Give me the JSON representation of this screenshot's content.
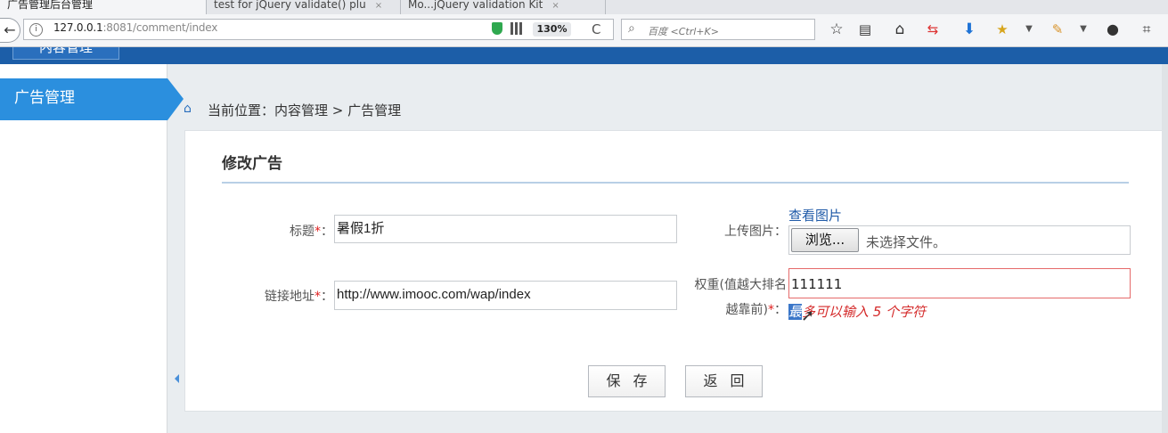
{
  "browser": {
    "tabs": [
      {
        "label": "广告管理后台管理",
        "active": true
      },
      {
        "label": "test for jQuery validate() plu"
      },
      {
        "label": "Mo...jQuery validation Kit"
      }
    ],
    "tab_close": "×",
    "back_label": "←",
    "info_label": "i",
    "url_host": "127.0.0.1",
    "url_rest": ":8081/comment/index",
    "zoom": "130%",
    "reload": "C",
    "search_placeholder": "百度 <Ctrl+K>",
    "toolbar_icons": [
      "star-icon",
      "reader-icon",
      "home-icon",
      "sync-icon",
      "download-icon",
      "addon-icon",
      "dropdown-icon",
      "extension-icon",
      "dropdown-icon",
      "chat-icon",
      "crop-icon"
    ]
  },
  "app": {
    "top_menu": "内容管理",
    "sidebar": {
      "active_item": "广告管理"
    },
    "breadcrumb": "当前位置：内容管理 > 广告管理"
  },
  "form": {
    "title": "修改广告",
    "fields": {
      "title_label": "标题",
      "title_value": "暑假1折",
      "link_label": "链接地址",
      "link_value": "http://www.imooc.com/wap/index",
      "upload_label": "上传图片：",
      "view_image": "查看图片",
      "browse": "浏览...",
      "no_file": "未选择文件。",
      "weight_label_1": "权重(值越大排名",
      "weight_label_2": "越靠前)",
      "weight_value": "111111",
      "weight_error_sel": "最",
      "weight_error_rest": "多可以输入 5 个字符"
    },
    "label_suffix": "：",
    "required_mark": "*",
    "save": "保存",
    "back": "返回"
  },
  "colors": {
    "brand": "#1c5ea8",
    "sidebar_active": "#2b8fde",
    "error": "#d42a2a"
  }
}
